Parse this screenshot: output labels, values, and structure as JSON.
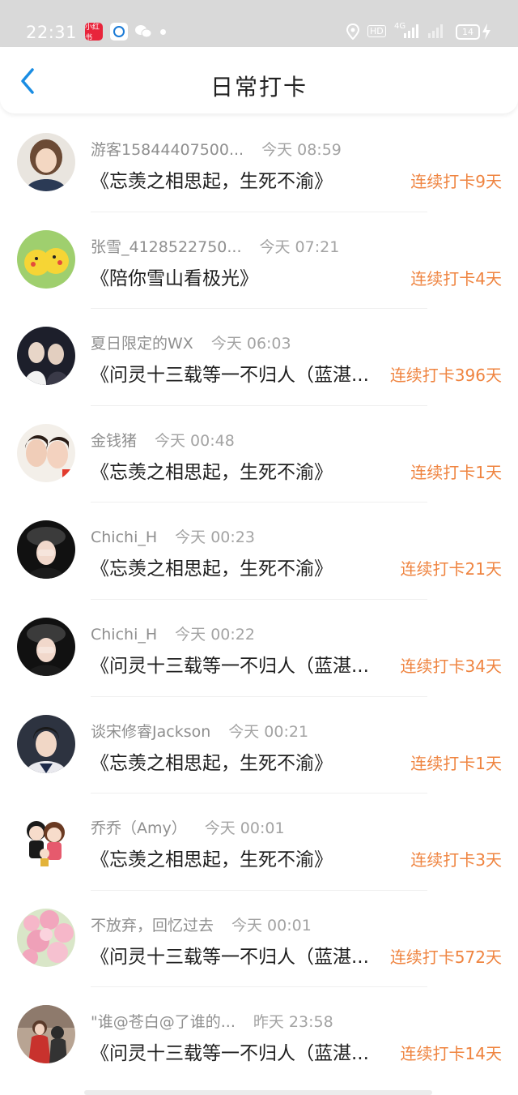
{
  "status_bar": {
    "time": "22:31",
    "app_icon_1": "小红书",
    "signal": "4G",
    "hd": "HD",
    "battery": "14"
  },
  "header": {
    "title": "日常打卡"
  },
  "colors": {
    "accent_blue": "#1a8de3",
    "streak_orange": "#ef8440",
    "meta_gray": "#8f8f8f"
  },
  "entries": [
    {
      "name": "游客15844407500...",
      "time": "今天 08:59",
      "book": "《忘羡之相思起，生死不渝》",
      "streak": "连续打卡9天"
    },
    {
      "name": "张雪_4128522750...",
      "time": "今天 07:21",
      "book": "《陪你雪山看极光》",
      "streak": "连续打卡4天"
    },
    {
      "name": "夏日限定的WX",
      "time": "今天 06:03",
      "book": "《问灵十三载等一不归人（蓝湛...",
      "streak": "连续打卡396天"
    },
    {
      "name": "金钱猪",
      "time": "今天 00:48",
      "book": "《忘羡之相思起，生死不渝》",
      "streak": "连续打卡1天"
    },
    {
      "name": "Chichi_H",
      "time": "今天 00:23",
      "book": "《忘羡之相思起，生死不渝》",
      "streak": "连续打卡21天"
    },
    {
      "name": "Chichi_H",
      "time": "今天 00:22",
      "book": "《问灵十三载等一不归人（蓝湛...",
      "streak": "连续打卡34天"
    },
    {
      "name": "谈宋修睿Jackson",
      "time": "今天 00:21",
      "book": "《忘羡之相思起，生死不渝》",
      "streak": "连续打卡1天"
    },
    {
      "name": "乔乔（Amy）",
      "time": "今天 00:01",
      "book": "《忘羡之相思起，生死不渝》",
      "streak": "连续打卡3天"
    },
    {
      "name": "不放弃，回忆过去",
      "time": "今天 00:01",
      "book": "《问灵十三载等一不归人（蓝湛...",
      "streak": "连续打卡572天"
    },
    {
      "name": "\"谁@苍白@了谁的...",
      "time": "昨天 23:58",
      "book": "《问灵十三载等一不归人（蓝湛...",
      "streak": "连续打卡14天"
    }
  ]
}
